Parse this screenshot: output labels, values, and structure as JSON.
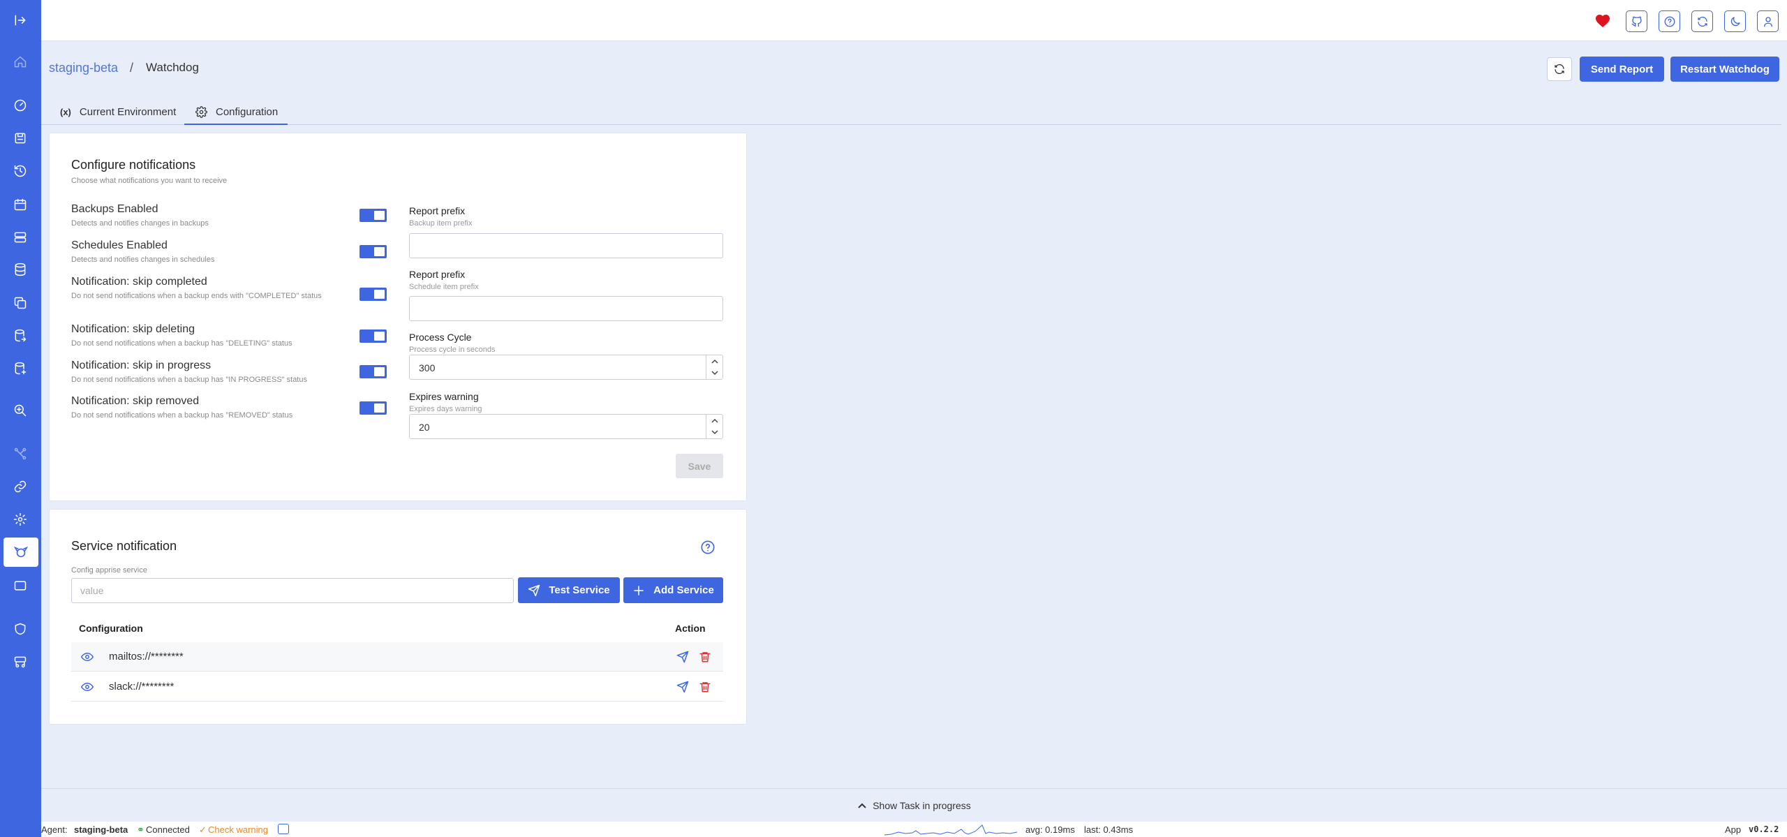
{
  "breadcrumb": {
    "parent": "staging-beta",
    "separator": "/",
    "current": "Watchdog"
  },
  "header_buttons": {
    "send_report": "Send Report",
    "restart": "Restart Watchdog"
  },
  "tabs": [
    {
      "icon_text": "(x)",
      "label": "Current Environment"
    },
    {
      "label": "Configuration"
    }
  ],
  "configure": {
    "title": "Configure notifications",
    "subtitle": "Choose what notifications you want to receive",
    "toggles": [
      {
        "label": "Backups Enabled",
        "desc": "Detects and notifies changes in backups",
        "on": true
      },
      {
        "label": "Schedules Enabled",
        "desc": "Detects and notifies changes in schedules",
        "on": true
      },
      {
        "label": "Notification: skip completed",
        "desc": "Do not send notifications when a backup ends with \"COMPLETED\" status",
        "on": true
      },
      {
        "label": "Notification: skip deleting",
        "desc": "Do not send notifications when a backup has \"DELETING\" status",
        "on": true
      },
      {
        "label": "Notification: skip in progress",
        "desc": "Do not send notifications when a backup has \"IN PROGRESS\" status",
        "on": true
      },
      {
        "label": "Notification: skip removed",
        "desc": "Do not send notifications when a backup has \"REMOVED\" status",
        "on": true
      }
    ],
    "fields": [
      {
        "label": "Report prefix",
        "sub": "Backup item prefix",
        "value": ""
      },
      {
        "label": "Report prefix",
        "sub": "Schedule item prefix",
        "value": ""
      },
      {
        "label": "Process Cycle",
        "sub": "Process cycle in seconds",
        "value": "300"
      },
      {
        "label": "Expires warning",
        "sub": "Expires days warning",
        "value": "20"
      }
    ],
    "save_label": "Save"
  },
  "service": {
    "title": "Service notification",
    "input_label": "Config apprise service",
    "input_placeholder": "value",
    "test_label": "Test Service",
    "add_label": "Add Service",
    "columns": [
      "Configuration",
      "Action"
    ],
    "rows": [
      "mailtos://********",
      "slack://********"
    ]
  },
  "task_bar": {
    "label": "Show Task in progress"
  },
  "status": {
    "agent_label": "Agent:",
    "agent_name": "staging-beta",
    "connected": "Connected",
    "check_warning": "Check warning",
    "avg": "avg: 0.19ms",
    "last": "last: 0.43ms",
    "app_label": "App",
    "version": "v0.2.2"
  },
  "colors": {
    "accent": "#3e66e0",
    "danger": "#e0302f",
    "warning": "#e88a2c",
    "heart": "#e0141e"
  }
}
